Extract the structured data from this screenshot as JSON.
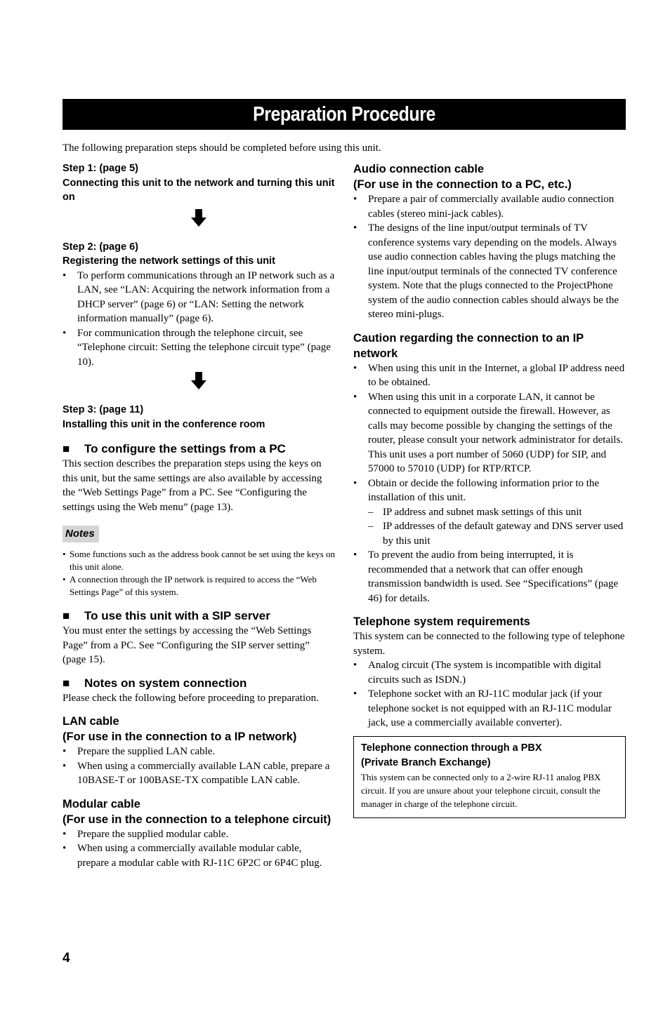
{
  "title": "Preparation Procedure",
  "intro": "The following preparation steps should be completed before using this unit.",
  "steps": [
    {
      "label": "Step 1: (page 5)",
      "heading": "Connecting this unit to the network and turning this unit on"
    },
    {
      "label": "Step 2: (page 6)",
      "heading": "Registering the network settings of this unit",
      "bullets": [
        "To perform communications through an IP network such as a LAN, see “LAN: Acquiring the network information from a DHCP server” (page 6) or “LAN: Setting the network information manually” (page 6).",
        "For communication through the telephone circuit, see “Telephone circuit: Setting the telephone circuit type” (page 10)."
      ]
    },
    {
      "label": "Step 3: (page 11)",
      "heading": "Installing this unit in the conference room"
    }
  ],
  "configure_pc": {
    "heading": "To configure the settings from a PC",
    "body": "This section describes the preparation steps using the keys on this unit, but the same settings are also available by accessing the “Web Settings Page” from a PC. See “Configuring the settings using the Web menu” (page 13)."
  },
  "notes": {
    "label": "Notes",
    "items": [
      "Some functions such as the address book cannot be set using the keys on this unit alone.",
      "A connection through the IP network is required to access the “Web Settings Page” of this system."
    ]
  },
  "sip_server": {
    "heading": "To use this unit with a SIP server",
    "body": "You must enter the settings by accessing the “Web Settings Page” from a PC. See “Configuring the SIP server setting” (page 15)."
  },
  "system_connection": {
    "heading": "Notes on system connection",
    "body": "Please check the following before proceeding to preparation."
  },
  "lan_cable": {
    "heading_1": "LAN cable",
    "heading_2": "(For use in the connection to a IP network)",
    "bullets": [
      "Prepare the supplied LAN cable.",
      "When using a commercially available LAN cable, prepare a 10BASE-T or 100BASE-TX compatible LAN cable."
    ]
  },
  "modular_cable": {
    "heading_1": "Modular cable",
    "heading_2": "(For use in the connection to a telephone circuit)",
    "bullets": [
      "Prepare the supplied modular cable.",
      "When using a commercially available modular cable, prepare a modular cable with RJ-11C 6P2C or 6P4C plug."
    ]
  },
  "audio_cable": {
    "heading_1": "Audio connection cable",
    "heading_2": "(For use in the connection to a PC, etc.)",
    "bullets": [
      "Prepare a pair of commercially available audio connection cables (stereo mini-jack cables).",
      "The designs of the line input/output terminals of TV conference systems vary depending on the models. Always use audio connection cables having the plugs matching the line input/output terminals of the connected TV conference system. Note that the plugs connected to the ProjectPhone system of the audio connection cables should always be the stereo mini-plugs."
    ]
  },
  "caution_ip": {
    "heading": "Caution regarding the connection to an IP network",
    "bullets": [
      "When using this unit in the Internet, a global IP address need to be obtained.",
      "When using this unit in a corporate LAN, it cannot be connected to equipment outside the firewall. However, as calls may become possible by changing the settings of the router, please consult your network administrator for details. This unit uses a port number of 5060 (UDP) for SIP, and 57000 to 57010 (UDP) for RTP/RTCP.",
      "Obtain or decide the following information prior to the installation of this unit."
    ],
    "sub_items": [
      "IP address and subnet mask settings of this unit",
      "IP addresses of the default gateway and DNS server used by this unit"
    ],
    "last_bullet": "To prevent the audio from being interrupted, it is recommended that a network that can offer enough transmission bandwidth is used. See “Specifications” (page 46) for details."
  },
  "telephone_req": {
    "heading": "Telephone system requirements",
    "body": "This system can be connected to the following type of telephone system.",
    "bullets": [
      "Analog circuit (The system is incompatible with digital circuits such as ISDN.)",
      "Telephone socket with an RJ-11C modular jack (if your telephone socket is not equipped with an RJ-11C modular jack, use a commercially available converter)."
    ]
  },
  "pbx_box": {
    "heading_1": "Telephone connection through a PBX",
    "heading_2": "(Private Branch Exchange)",
    "body": "This system can be connected only to a 2-wire RJ-11 analog PBX circuit. If you are unsure about your telephone circuit, consult the manager in charge of the telephone circuit."
  },
  "icons": {
    "step_arrow": "down-arrow-icon",
    "section_marker": "black-square-icon"
  },
  "page_number": "4"
}
